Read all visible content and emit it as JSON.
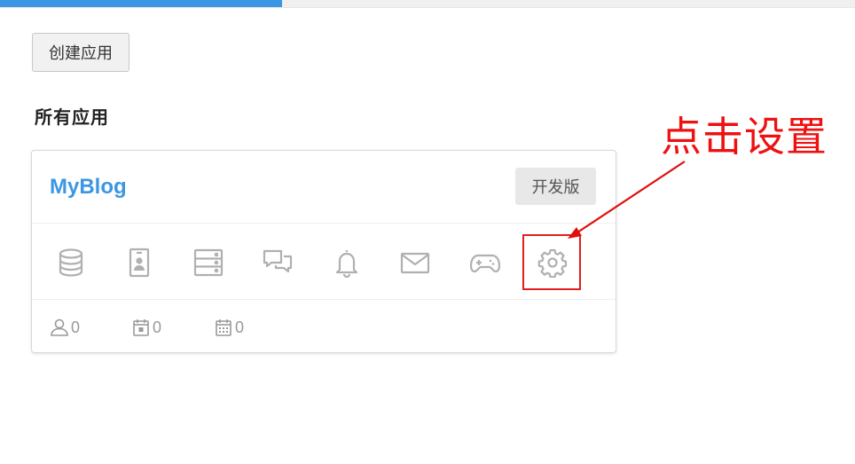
{
  "progress": {
    "value_percent": 33,
    "color": "#3b97e3"
  },
  "toolbar": {
    "create_label": "创建应用"
  },
  "section": {
    "title": "所有应用"
  },
  "app": {
    "name": "MyBlog",
    "edition": "开发版",
    "accent_color": "#3b97e3",
    "feature_icons": [
      "database-icon",
      "contact-card-icon",
      "server-icon",
      "chat-icon",
      "bell-icon",
      "mail-icon",
      "gamepad-icon",
      "settings-gear-icon"
    ],
    "stats": {
      "users": "0",
      "calendar_a": "0",
      "calendar_b": "0"
    }
  },
  "annotation": {
    "text": "点击设置",
    "color": "#ee1111"
  }
}
